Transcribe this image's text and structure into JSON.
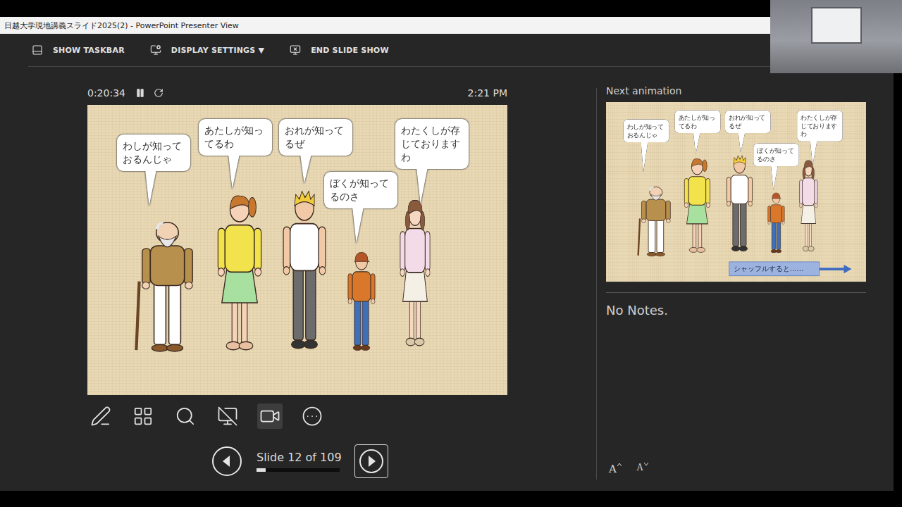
{
  "window": {
    "title": "日越大学現地講義スライド2025(2) - PowerPoint Presenter View"
  },
  "toolbar": [
    {
      "label": "SHOW TASKBAR",
      "kind": "taskbar"
    },
    {
      "label": "DISPLAY SETTINGS ▼",
      "kind": "display"
    },
    {
      "label": "END SLIDE SHOW",
      "kind": "end"
    }
  ],
  "timer": {
    "elapsed": "0:20:34",
    "running": true,
    "clock": "2:21 PM"
  },
  "slide": {
    "characters": [
      {
        "kind": "elder",
        "speech": "わしが知っておるんじゃ",
        "color": "#b8904e"
      },
      {
        "kind": "woman",
        "speech": "あたしが知ってるわ",
        "color": "#f2e24c"
      },
      {
        "kind": "man",
        "speech": "おれが知ってるぜ",
        "color": "#ffffff"
      },
      {
        "kind": "boy",
        "speech": "ぼくが知ってるのさ",
        "color": "#d9772b"
      },
      {
        "kind": "girl",
        "speech": "わたくしが存じておりますわ",
        "color": "#f3dbe8"
      }
    ]
  },
  "tools": [
    {
      "kind": "pen",
      "selected": false
    },
    {
      "kind": "slides",
      "selected": false
    },
    {
      "kind": "zoom",
      "selected": false
    },
    {
      "kind": "screen",
      "selected": false
    },
    {
      "kind": "camera",
      "selected": true
    },
    {
      "kind": "more",
      "selected": false
    }
  ],
  "navigation": {
    "counter": "Slide 12 of 109",
    "level": 0.11,
    "next_hovered": true
  },
  "notes_panel": {
    "heading": "Next animation",
    "preview": {
      "characters": [
        {
          "kind": "elder",
          "speech": "わしが知っておるんじゃ",
          "color": "#b8904e"
        },
        {
          "kind": "woman",
          "speech": "あたしが知ってるわ",
          "color": "#f2e24c"
        },
        {
          "kind": "man",
          "speech": "おれが知ってるぜ",
          "color": "#ffffff"
        },
        {
          "kind": "boy",
          "speech": "ぼくが知ってるのさ",
          "color": "#d9772b"
        },
        {
          "kind": "girl",
          "speech": "わたくしが存じておりますわ",
          "color": "#f3dbe8"
        }
      ],
      "button": "シャッフルすると……"
    },
    "notes": "No Notes.",
    "font_buttons": [
      {
        "label": "A",
        "kind": "increase"
      },
      {
        "label": "A",
        "kind": "decrease"
      }
    ]
  }
}
